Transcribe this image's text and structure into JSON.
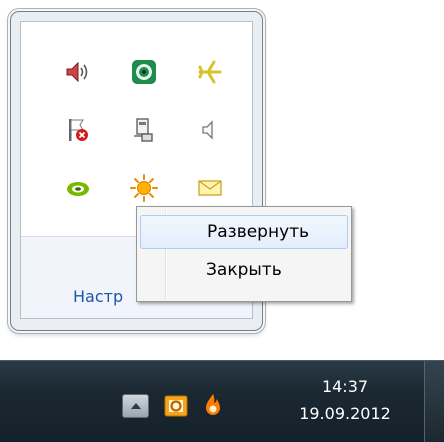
{
  "tray_popup": {
    "icons": [
      {
        "name": "volume-icon"
      },
      {
        "name": "green-circle-app-icon"
      },
      {
        "name": "yellow-airplane-icon"
      },
      {
        "name": "action-center-error-icon"
      },
      {
        "name": "network-disconnected-icon"
      },
      {
        "name": "speaker-outline-icon"
      },
      {
        "name": "nvidia-icon"
      },
      {
        "name": "sun-weather-icon"
      },
      {
        "name": "mail-envelope-icon"
      }
    ],
    "customize_link": "Настр"
  },
  "context_menu": {
    "items": [
      "Развернуть",
      "Закрыть"
    ]
  },
  "taskbar": {
    "time": "14:37",
    "date": "19.09.2012",
    "colors": {
      "start": "#2a3a46",
      "end": "#14202a"
    }
  }
}
